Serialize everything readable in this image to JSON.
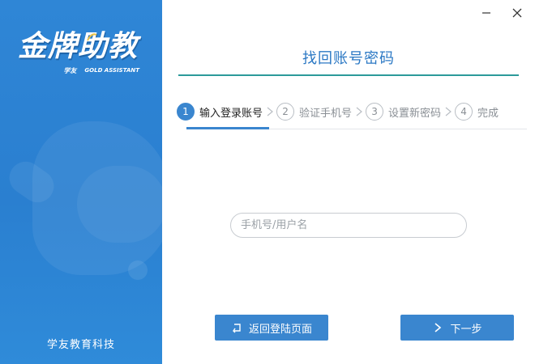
{
  "brand": {
    "logo_title": "金牌助教",
    "logo_brand_cn": "学友",
    "logo_brand_en": "GOLD ASSISTANT",
    "company_name": "学友教育科技"
  },
  "window": {
    "minimize_icon": "minimize-icon",
    "close_icon": "close-icon"
  },
  "main": {
    "title": "找回账号密码",
    "steps": [
      {
        "num": "1",
        "label": "输入登录账号",
        "active": true
      },
      {
        "num": "2",
        "label": "验证手机号",
        "active": false
      },
      {
        "num": "3",
        "label": "设置新密码",
        "active": false
      },
      {
        "num": "4",
        "label": "完成",
        "active": false
      }
    ],
    "account_input": {
      "placeholder": "手机号/用户名",
      "value": ""
    },
    "back_button": "返回登陆页面",
    "next_button": "下一步"
  },
  "colors": {
    "brand_blue": "#2f86d6",
    "accent_blue": "#3a86cf",
    "title_blue": "#2b78c4",
    "rule_teal": "#2c9a9a"
  }
}
